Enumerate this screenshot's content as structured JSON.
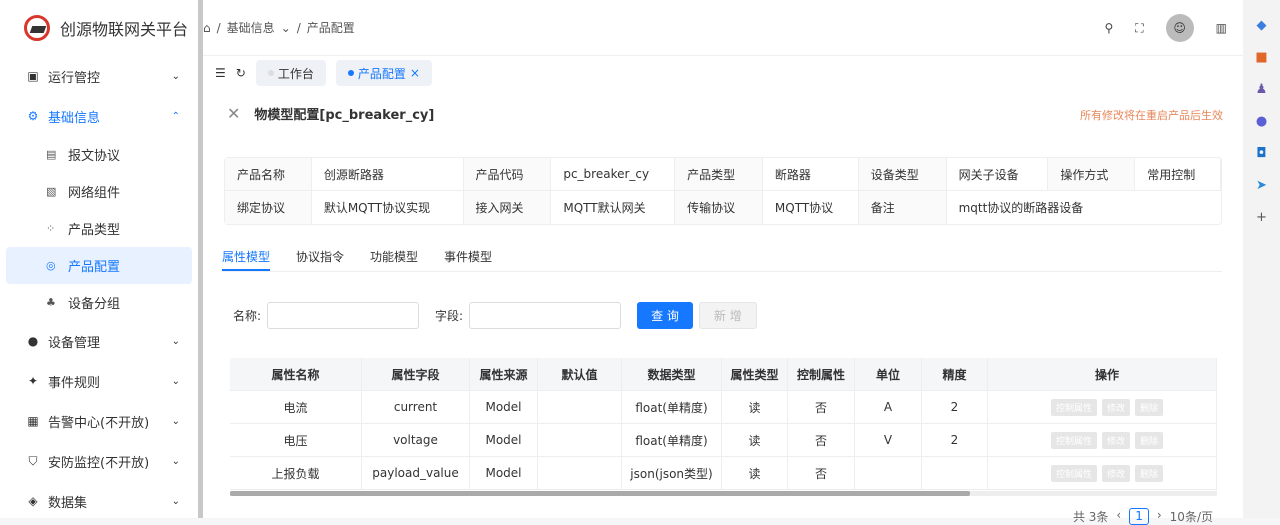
{
  "app": {
    "title": "创源物联网关平台"
  },
  "breadcrumb": [
    "基础信息",
    "产品配置"
  ],
  "sidebar": {
    "items": [
      {
        "label": "运行管控",
        "icon": "monitor-icon"
      },
      {
        "label": "基础信息",
        "icon": "gear-screen-icon"
      },
      {
        "label": "设备管理",
        "icon": "device-icon"
      },
      {
        "label": "事件规则",
        "icon": "rule-icon"
      },
      {
        "label": "告警中心(不开放)",
        "icon": "alarm-icon"
      },
      {
        "label": "安防监控(不开放)",
        "icon": "shield-icon"
      },
      {
        "label": "数据集",
        "icon": "layers-icon"
      }
    ],
    "sub": [
      "报文协议",
      "网络组件",
      "产品类型",
      "产品配置",
      "设备分组"
    ]
  },
  "tabs": {
    "home": "工作台",
    "current": "产品配置"
  },
  "page": {
    "title": "物模型配置[pc_breaker_cy]",
    "notice": "所有修改将在重启产品后生效"
  },
  "info": {
    "row1": [
      "产品名称",
      "创源断路器",
      "产品代码",
      "pc_breaker_cy",
      "产品类型",
      "断路器",
      "设备类型",
      "网关子设备",
      "操作方式",
      "常用控制"
    ],
    "row2": [
      "绑定协议",
      "默认MQTT协议实现",
      "接入网关",
      "MQTT默认网关",
      "传输协议",
      "MQTT协议",
      "备注",
      "mqtt协议的断路器设备"
    ]
  },
  "model_tabs": [
    "属性模型",
    "协议指令",
    "功能模型",
    "事件模型"
  ],
  "search": {
    "name_label": "名称:",
    "field_label": "字段:",
    "query": "查 询",
    "add": "新 增"
  },
  "table": {
    "headers": [
      "属性名称",
      "属性字段",
      "属性来源",
      "默认值",
      "数据类型",
      "属性类型",
      "控制属性",
      "单位",
      "精度",
      "操作"
    ],
    "rows": [
      [
        "电流",
        "current",
        "Model",
        "",
        "float(单精度)",
        "读",
        "否",
        "A",
        "2"
      ],
      [
        "电压",
        "voltage",
        "Model",
        "",
        "float(单精度)",
        "读",
        "否",
        "V",
        "2"
      ],
      [
        "上报负载",
        "payload_value",
        "Model",
        "",
        "json(json类型)",
        "读",
        "否",
        "",
        ""
      ]
    ],
    "ops": [
      "控制属性",
      "修改",
      "删除"
    ]
  },
  "pager": {
    "total": "共 3条",
    "page": "1",
    "size": "10条/页"
  }
}
